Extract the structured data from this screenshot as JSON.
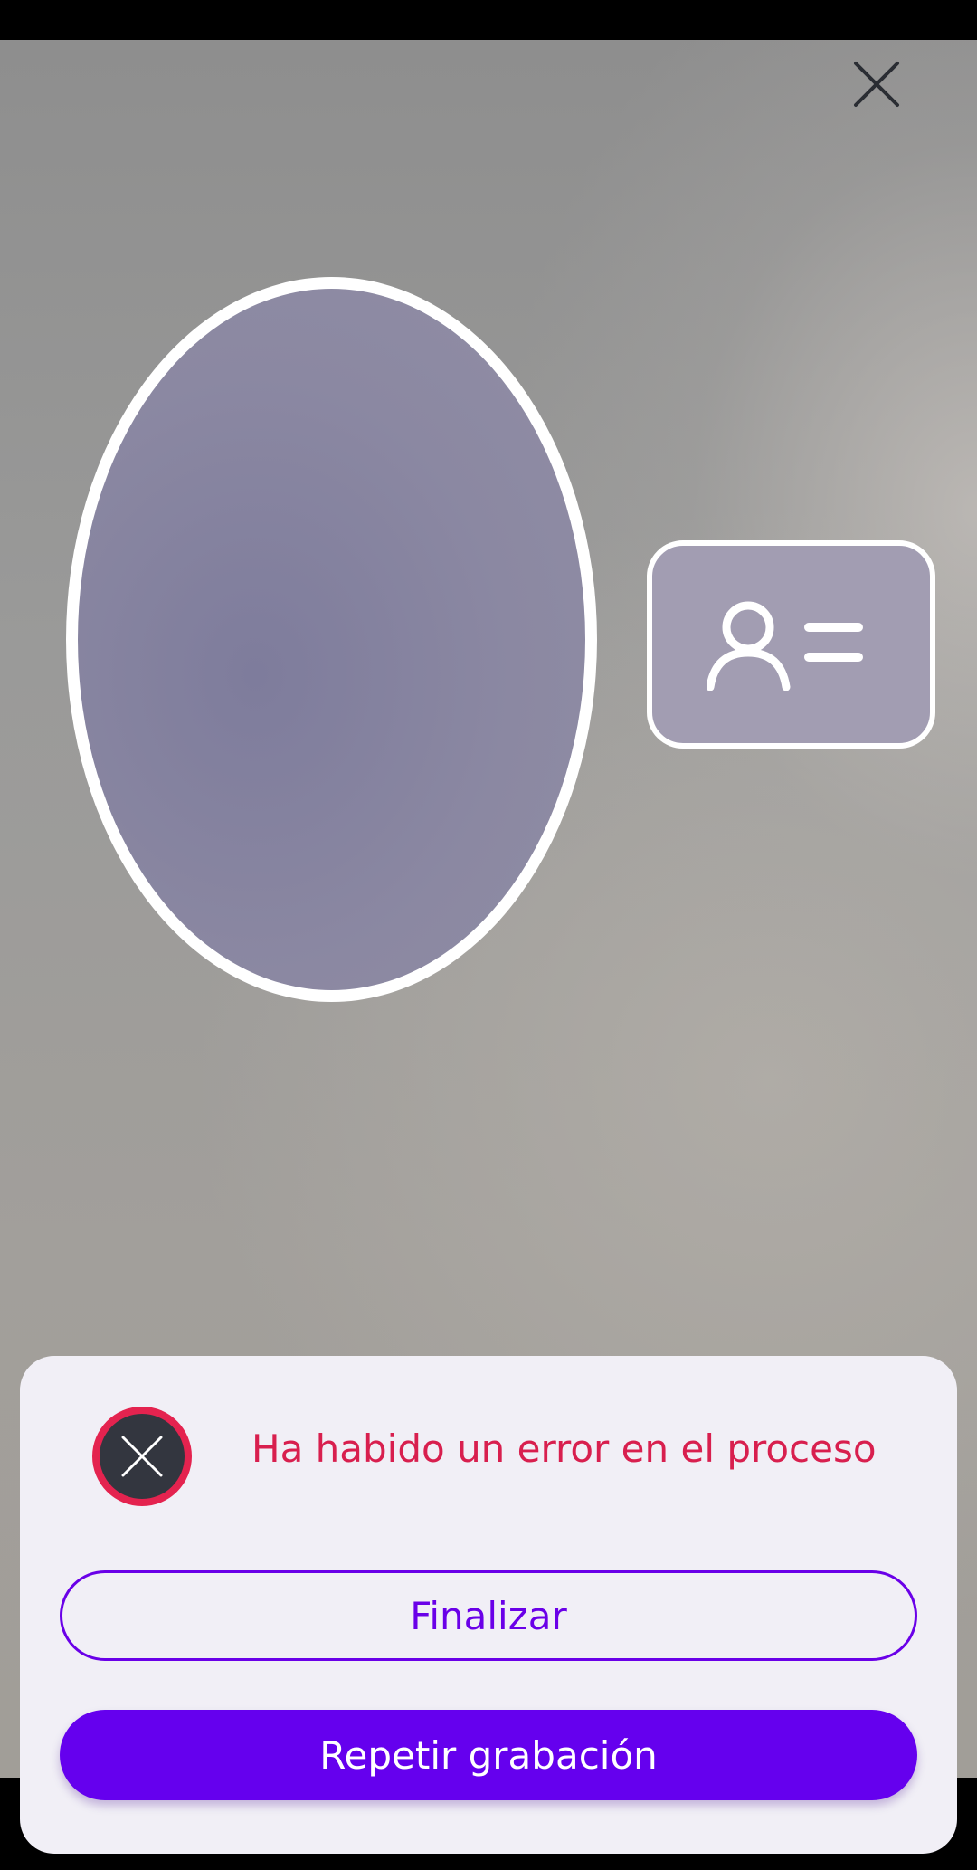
{
  "header": {
    "close_icon": "close-icon"
  },
  "capture": {
    "face_guide": "face-oval-guide",
    "id_card_icon": "id-card-icon"
  },
  "dialog": {
    "error_icon": "error-x-icon",
    "message": "Ha habido un error en el proceso",
    "finish_label": "Finalizar",
    "retry_label": "Repetir grabación",
    "colors": {
      "error": "#d81f4e",
      "primary": "#6500ee",
      "sheet": "#f1eff6"
    }
  }
}
